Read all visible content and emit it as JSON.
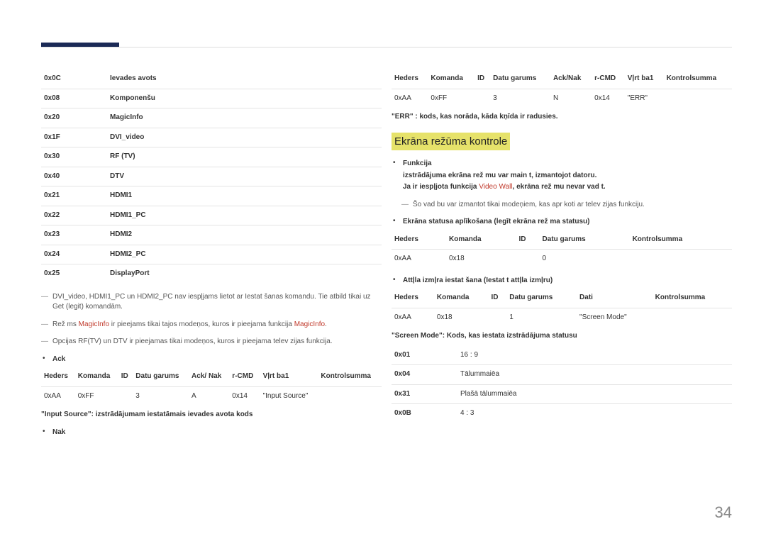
{
  "page_number": "34",
  "left": {
    "sources": [
      {
        "code": "0x0C",
        "name": "Ievades avots"
      },
      {
        "code": "0x08",
        "name": "Komponenšu"
      },
      {
        "code": "0x20",
        "name": "MagicInfo"
      },
      {
        "code": "0x1F",
        "name": "DVI_video"
      },
      {
        "code": "0x30",
        "name": "RF (TV)"
      },
      {
        "code": "0x40",
        "name": "DTV"
      },
      {
        "code": "0x21",
        "name": "HDMI1"
      },
      {
        "code": "0x22",
        "name": "HDMI1_PC"
      },
      {
        "code": "0x23",
        "name": "HDMI2"
      },
      {
        "code": "0x24",
        "name": "HDMI2_PC"
      },
      {
        "code": "0x25",
        "name": "DisplayPort"
      }
    ],
    "note1": "DVI_video, HDMI1_PC un HDMI2_PC nav iespļjams lietot ar Iestat šanas komandu. Tie atbild tikai uz Get (legit) komandām.",
    "note2_pre": "Rež ms ",
    "note2_mid": "MagicInfo",
    "note2_post": " ir pieejams tikai tajos modeņos, kuros ir pieejama funkcija ",
    "note2_post2": "MagicInfo",
    "note2_end": ".",
    "note3": "Opcijas RF(TV) un DTV ir pieejamas tikai modeņos, kuros ir pieejama telev zijas funkcija.",
    "ack_label": "Ack",
    "ack_headers": [
      "Heders",
      "Komanda",
      "ID",
      "Datu garums",
      "Ack/ Nak",
      "r-CMD",
      "Vļrt ba1",
      "Kontrolsumma"
    ],
    "ack_row": [
      "0xAA",
      "0xFF",
      "",
      "3",
      "A",
      "0x14",
      "\"Input Source\"",
      ""
    ],
    "input_source_note": "\"Input Source\": izstrādājumam iestatāmais ievades avota kods",
    "nak_label": "Nak"
  },
  "right": {
    "nak_headers": [
      "Heders",
      "Komanda",
      "ID",
      "Datu garums",
      "Ack/Nak",
      "r-CMD",
      "Vļrt ba1",
      "Kontrolsumma"
    ],
    "nak_row": [
      "0xAA",
      "0xFF",
      "",
      "3",
      "N",
      "0x14",
      "\"ERR\"",
      ""
    ],
    "err_note": "\"ERR\" : kods, kas norāda, kāda kņīda ir radusies.",
    "section_title": "Ekrāna režūma kontrole",
    "func_label": "Funkcija",
    "func_lines": [
      "izstrādājuma ekrāna rež mu var main t, izmantojot datoru.",
      "Ja ir iespļjota funkcija Video Wall, ekrāna rež mu nevar vad t."
    ],
    "func_note": "Šo vad bu var izmantot tikai modeņiem, kas apr koti ar telev zijas funkciju.",
    "view_label": "Ekrāna statusa aplīkošana (legīt ekrāna rež ma statusu)",
    "view_headers": [
      "Heders",
      "Komanda",
      "ID",
      "Datu garums",
      "Kontrolsumma"
    ],
    "view_row": [
      "0xAA",
      "0x18",
      "",
      "0",
      ""
    ],
    "set_label": "Attļla izmļra iestat šana (Iestat t attļla izmļru)",
    "set_headers": [
      "Heders",
      "Komanda",
      "ID",
      "Datu garums",
      "Dati",
      "Kontrolsumma"
    ],
    "set_row": [
      "0xAA",
      "0x18",
      "",
      "1",
      "\"Screen Mode\"",
      ""
    ],
    "screen_mode_note": "\"Screen Mode\": Kods, kas iestata izstrādājuma statusu",
    "modes": [
      {
        "code": "0x01",
        "name": "16 : 9"
      },
      {
        "code": "0x04",
        "name": "Tālummaiēa"
      },
      {
        "code": "0x31",
        "name": "Plašā tālummaiēa"
      },
      {
        "code": "0x0B",
        "name": "4 : 3"
      }
    ]
  }
}
